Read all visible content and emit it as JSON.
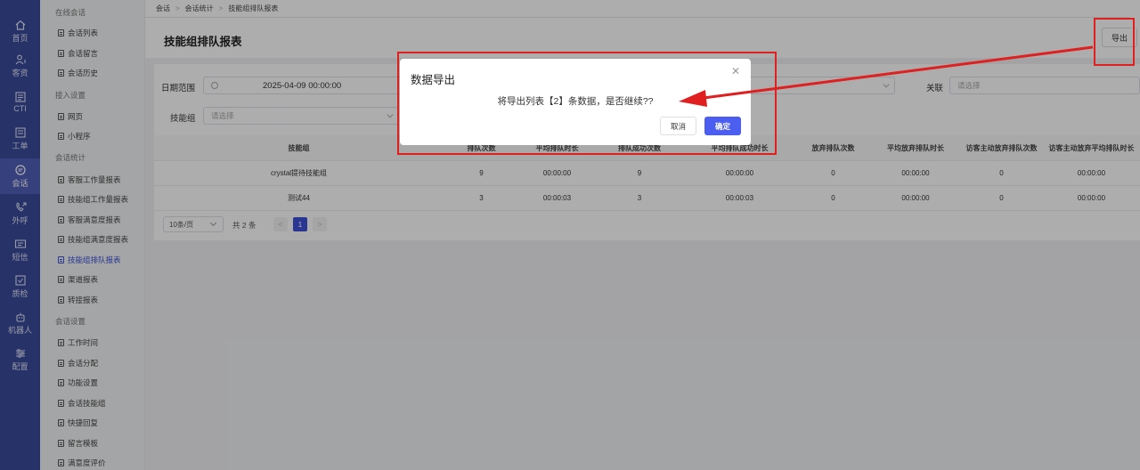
{
  "rail": [
    {
      "label": "首页",
      "icon": "home-icon"
    },
    {
      "label": "客资",
      "icon": "customer-icon"
    },
    {
      "label": "CTI",
      "icon": "cti-icon"
    },
    {
      "label": "工单",
      "icon": "ticket-icon"
    },
    {
      "label": "会话",
      "icon": "chat-icon",
      "active": true
    },
    {
      "label": "外呼",
      "icon": "phone-out-icon"
    },
    {
      "label": "短信",
      "icon": "sms-icon"
    },
    {
      "label": "质检",
      "icon": "quality-icon"
    },
    {
      "label": "机器人",
      "icon": "robot-icon"
    },
    {
      "label": "配置",
      "icon": "settings-icon"
    }
  ],
  "submenu": {
    "groups": [
      "在线会话",
      "接入设置",
      "会话统计",
      "会话设置"
    ],
    "items": [
      "会话列表",
      "会话留言",
      "会话历史",
      "网页",
      "小程序",
      "客服工作量报表",
      "技能组工作量报表",
      "客服满意度报表",
      "技能组满意度报表",
      "技能组排队报表",
      "渠道报表",
      "转接报表",
      "工作时间",
      "会话分配",
      "功能设置",
      "会话技能组",
      "快捷回复",
      "留言模板",
      "满意度评价"
    ]
  },
  "breadcrumb": [
    "会话",
    "会话统计",
    "技能组排队报表"
  ],
  "page_title": "技能组排队报表",
  "export_label": "导出",
  "filters": {
    "date_label": "日期范围",
    "date_value": "2025-04-09 00:00:00",
    "related_label": "关联",
    "related_placeholder": "请选择",
    "skill_label": "技能组",
    "skill_placeholder": "请选择"
  },
  "table": {
    "headers": [
      "技能组",
      "排队次数",
      "平均排队时长",
      "排队成功次数",
      "平均排队成功时长",
      "放弃排队次数",
      "平均放弃排队时长",
      "访客主动放弃排队次数",
      "访客主动放弃平均排队时长"
    ],
    "rows": [
      [
        "crystal提待技能组",
        "9",
        "00:00:00",
        "9",
        "00:00:00",
        "0",
        "00:00:00",
        "0",
        "00:00:00"
      ],
      [
        "测试44",
        "3",
        "00:00:03",
        "3",
        "00:00:03",
        "0",
        "00:00:00",
        "0",
        "00:00:00"
      ]
    ]
  },
  "pager": {
    "size": "10条/页",
    "total": "共 2 条",
    "current": "1"
  },
  "dialog": {
    "title": "数据导出",
    "message": "将导出列表【2】条数据，是否继续??",
    "cancel": "取消",
    "ok": "确定"
  },
  "colors": {
    "rail": "#3a4a9a",
    "accent": "#3f51d8",
    "confirm": "#4c5ef0",
    "annotation": "#e02020"
  }
}
